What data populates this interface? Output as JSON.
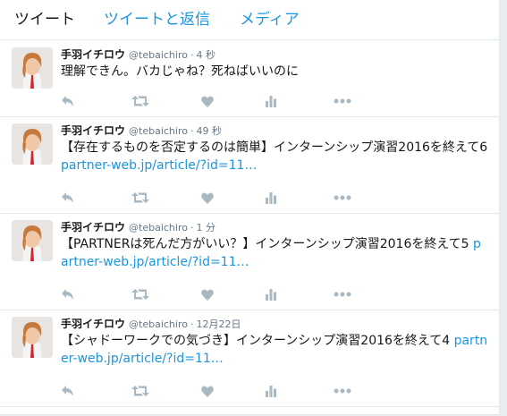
{
  "tabs": [
    "ツイート",
    "ツイートと返信",
    "メディア"
  ],
  "tweets": [
    {
      "name": "手羽イチロウ",
      "handle": "@tebaichiro",
      "time": "4 秒",
      "text": "理解できん。バカじゃね？死ねばいいのに",
      "link": ""
    },
    {
      "name": "手羽イチロウ",
      "handle": "@tebaichiro",
      "time": "49 秒",
      "text": "【存在するものを否定するのは簡単】インターンシップ演習2016を終えて6 ",
      "link": "partner-web.jp/article/?id=11…"
    },
    {
      "name": "手羽イチロウ",
      "handle": "@tebaichiro",
      "time": "1 分",
      "text": "【PARTNERは死んだ方がいい？】インターンシップ演習2016を終えて5 ",
      "link": "partner-web.jp/article/?id=11…"
    },
    {
      "name": "手羽イチロウ",
      "handle": "@tebaichiro",
      "time": "12月22日",
      "text": "【シャドーワークでの気づき】インターンシップ演習2016を終えて4 ",
      "link": "partner-web.jp/article/?id=11…"
    }
  ],
  "icons": [
    "reply-icon",
    "retweet-icon",
    "like-icon",
    "analytics-icon",
    "more-icon"
  ],
  "colors": {
    "accent": "#1b95e0",
    "icon": "#aab8c2",
    "text": "#14171a",
    "muted": "#657786"
  }
}
